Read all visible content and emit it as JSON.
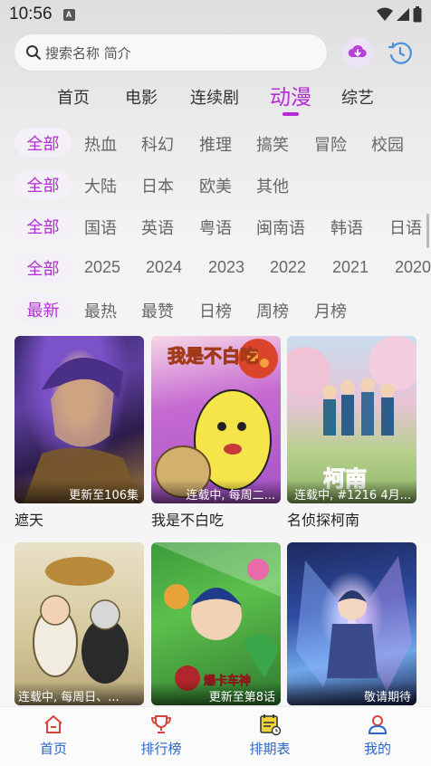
{
  "status_bar": {
    "time": "10:56",
    "notification_letter": "A"
  },
  "search": {
    "placeholder": "搜索名称 简介",
    "download_icon": "cloud-download-icon",
    "history_icon": "history-clock-icon"
  },
  "category_tabs": [
    {
      "label": "首页",
      "active": false
    },
    {
      "label": "电影",
      "active": false
    },
    {
      "label": "连续剧",
      "active": false
    },
    {
      "label": "动漫",
      "active": true
    },
    {
      "label": "综艺",
      "active": false
    }
  ],
  "filters": {
    "genre": {
      "selected": "全部",
      "options": [
        "热血",
        "科幻",
        "推理",
        "搞笑",
        "冒险",
        "校园"
      ]
    },
    "region": {
      "selected": "全部",
      "options": [
        "大陆",
        "日本",
        "欧美",
        "其他"
      ]
    },
    "language": {
      "selected": "全部",
      "options": [
        "国语",
        "英语",
        "粤语",
        "闽南语",
        "韩语",
        "日语"
      ]
    },
    "year": {
      "selected": "全部",
      "options": [
        "2025",
        "2024",
        "2023",
        "2022",
        "2021",
        "2020"
      ]
    },
    "sort": {
      "selected": "最新",
      "options": [
        "最热",
        "最赞",
        "日榜",
        "周榜",
        "月榜"
      ]
    }
  },
  "cards": [
    {
      "title": "遮天",
      "badge": "更新至106集"
    },
    {
      "title": "我是不白吃",
      "badge": "连载中, 每周二..."
    },
    {
      "title": "名侦探柯南",
      "badge": "连载中, #1216 4月..."
    },
    {
      "title": "",
      "badge": "连载中, 每周日、..."
    },
    {
      "title": "",
      "badge": "更新至第8话"
    },
    {
      "title": "",
      "badge": "敬请期待"
    }
  ],
  "poster_text": {
    "card2_art": "我是不白吃",
    "card3_art": "柯南",
    "card5_art": "爆卡车神"
  },
  "bottom_nav": [
    {
      "label": "首页",
      "icon": "home-icon"
    },
    {
      "label": "排行榜",
      "icon": "trophy-icon"
    },
    {
      "label": "排期表",
      "icon": "schedule-icon"
    },
    {
      "label": "我的",
      "icon": "user-icon"
    }
  ],
  "colors": {
    "accent": "#b52bd6",
    "nav_blue": "#2e66c9",
    "chip_bg": "#f4f0f7"
  }
}
